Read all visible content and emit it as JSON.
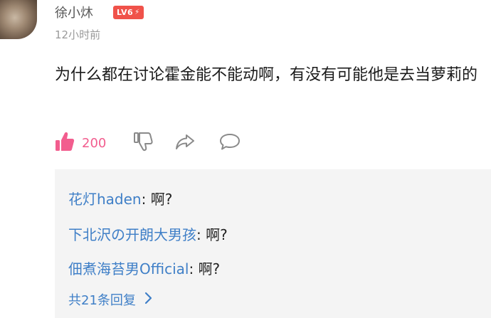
{
  "comment": {
    "username": "徐小炑",
    "level_badge": "LV6",
    "timestamp": "12小时前",
    "text": "为什么都在讨论霍金能不能动啊，有没有可能他是去当萝莉的"
  },
  "actions": {
    "like_count": "200",
    "like_color": "#f25d8e",
    "icons": [
      "thumbs-up-icon",
      "thumbs-down-icon",
      "share-icon",
      "reply-bubble-icon"
    ]
  },
  "replies": {
    "items": [
      {
        "name": "花灯haden",
        "sep": ": ",
        "text": "啊?"
      },
      {
        "name": "下北沢の开朗大男孩",
        "sep": ": ",
        "text": "啊?"
      },
      {
        "name": "佃煮海苔男Official",
        "sep": ": ",
        "text": "啊?"
      }
    ],
    "more_label": "共21条回复"
  },
  "colors": {
    "link_blue": "#3f7fc7",
    "badge_red": "#f0524a"
  }
}
